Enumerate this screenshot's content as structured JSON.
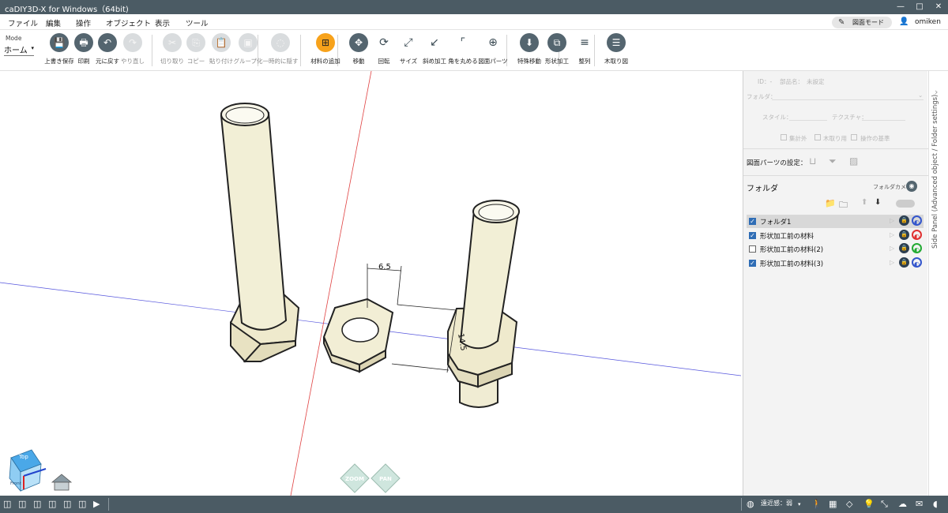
{
  "window": {
    "title": "caDIY3D-X for Windows（64bit)",
    "minimize": "—",
    "maximize": "□",
    "close": "✕"
  },
  "menu": {
    "items": [
      "ファイル",
      "編集",
      "操作",
      "オブジェクト",
      "表示",
      "ツール"
    ],
    "drawing_mode": "図面モード",
    "user": "omiken"
  },
  "toolbar": {
    "mode_label": "Mode",
    "mode_value": "ホーム",
    "buttons": [
      {
        "label": "上書き保存",
        "icon": "save-icon",
        "glyph": "💾",
        "enabled": true
      },
      {
        "label": "印刷",
        "icon": "print-icon",
        "glyph": "🖶",
        "enabled": true
      },
      {
        "label": "元に戻す",
        "icon": "undo-icon",
        "glyph": "↶",
        "enabled": true
      },
      {
        "label": "やり直し",
        "icon": "redo-icon",
        "glyph": "↷",
        "enabled": false
      },
      {
        "label": "切り取り",
        "icon": "cut-icon",
        "glyph": "✂",
        "enabled": false
      },
      {
        "label": "コピー",
        "icon": "copy-icon",
        "glyph": "⎘",
        "enabled": false
      },
      {
        "label": "貼り付け",
        "icon": "paste-icon",
        "glyph": "📋",
        "enabled": false
      },
      {
        "label": "グループ化",
        "icon": "group-icon",
        "glyph": "▣",
        "enabled": false
      },
      {
        "label": "一時的に隠す",
        "icon": "hide-icon",
        "glyph": "◌",
        "enabled": false
      },
      {
        "label": "材料の追加",
        "icon": "add-material-icon",
        "glyph": "⊞",
        "enabled": true
      },
      {
        "label": "移動",
        "icon": "move-icon",
        "glyph": "✥",
        "enabled": true
      },
      {
        "label": "回転",
        "icon": "rotate-icon",
        "glyph": "⟳",
        "enabled": true
      },
      {
        "label": "サイズ",
        "icon": "resize-icon",
        "glyph": "⤢",
        "enabled": true
      },
      {
        "label": "斜め加工",
        "icon": "bevel-icon",
        "glyph": "↙",
        "enabled": true
      },
      {
        "label": "角を丸める",
        "icon": "round-corner-icon",
        "glyph": "⌜",
        "enabled": true
      },
      {
        "label": "図面パーツ",
        "icon": "drawing-parts-icon",
        "glyph": "⊕",
        "enabled": true
      },
      {
        "label": "特殊移動",
        "icon": "special-move-icon",
        "glyph": "⬇",
        "enabled": true
      },
      {
        "label": "形状加工",
        "icon": "shape-processing-icon",
        "glyph": "⧉",
        "enabled": true
      },
      {
        "label": "整列",
        "icon": "align-icon",
        "glyph": "≡",
        "enabled": true
      },
      {
        "label": "木取り図",
        "icon": "cut-list-icon",
        "glyph": "☰",
        "enabled": true
      }
    ]
  },
  "viewport": {
    "dimension_width": "6.5",
    "dimension_height": "14.5",
    "cube_top": "Top",
    "cube_front": "Front",
    "nav_zoom": "ZOOM",
    "nav_pan": "PAN"
  },
  "side_panel": {
    "id_label": "ID：-",
    "part_name_label": "部品名：",
    "part_name_placeholder": "未設定",
    "folder_label": "フォルダ：",
    "style_label": "スタイル：",
    "texture_label": "テクスチャ：",
    "checks": [
      "集計外",
      "木取り用",
      "操作の基準"
    ],
    "drawing_parts_setting": "図面パーツの設定：",
    "folder_section": "フォルダ",
    "folder_camera": "フォルダカメラ",
    "vertical_tab": "Side Panel (Advanced object / Folder settings)",
    "folders": [
      {
        "name": "フォルダ1",
        "checked": true,
        "selected": true,
        "color": "#3355cc"
      },
      {
        "name": "形状加工前の材料",
        "checked": true,
        "selected": false,
        "color": "#e03030"
      },
      {
        "name": "形状加工前の材料(2)",
        "checked": false,
        "selected": false,
        "color": "#22aa33"
      },
      {
        "name": "形状加工前の材料(3)",
        "checked": true,
        "selected": false,
        "color": "#3355cc"
      }
    ]
  },
  "statusbar": {
    "clipping_label": "遠近感：弱"
  },
  "colors": {
    "titlebar": "#4b5b64",
    "accent_orange": "#f7a21b",
    "model_fill": "#f5f2dc"
  }
}
